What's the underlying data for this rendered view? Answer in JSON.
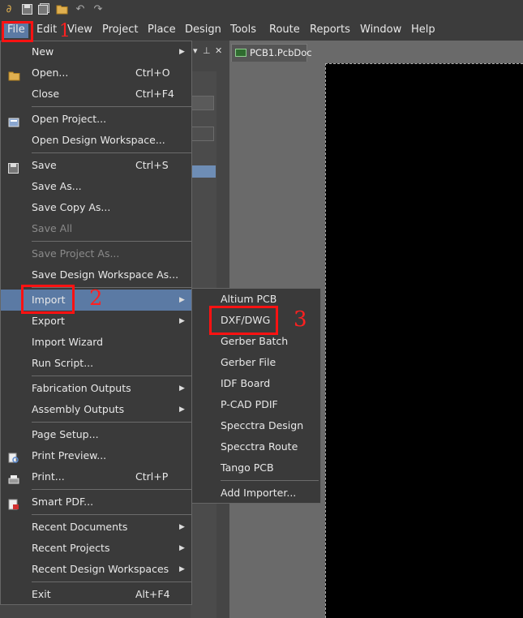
{
  "toolbar": {
    "icons": [
      "app-logo-icon",
      "save-icon",
      "save-all-icon",
      "open-folder-icon",
      "undo-icon",
      "redo-icon"
    ]
  },
  "menubar": {
    "items": [
      "File",
      "Edit",
      "View",
      "Project",
      "Place",
      "Design",
      "Tools",
      "Route",
      "Reports",
      "Window",
      "Help"
    ]
  },
  "document_tab": {
    "label": "PCB1.PcbDoc"
  },
  "file_menu": {
    "items": [
      {
        "label": "New",
        "submenu": true
      },
      {
        "label": "Open...",
        "shortcut": "Ctrl+O"
      },
      {
        "label": "Close",
        "shortcut": "Ctrl+F4"
      },
      {
        "label": "Open Project..."
      },
      {
        "label": "Open Design Workspace..."
      },
      {
        "label": "Save",
        "shortcut": "Ctrl+S"
      },
      {
        "label": "Save As..."
      },
      {
        "label": "Save Copy As..."
      },
      {
        "label": "Save All",
        "disabled": true
      },
      {
        "label": "Save Project As...",
        "disabled": true
      },
      {
        "label": "Save Design Workspace As..."
      },
      {
        "label": "Import",
        "submenu": true,
        "highlighted": true
      },
      {
        "label": "Export",
        "submenu": true
      },
      {
        "label": "Import Wizard"
      },
      {
        "label": "Run Script..."
      },
      {
        "label": "Fabrication Outputs",
        "submenu": true
      },
      {
        "label": "Assembly Outputs",
        "submenu": true
      },
      {
        "label": "Page Setup..."
      },
      {
        "label": "Print Preview..."
      },
      {
        "label": "Print...",
        "shortcut": "Ctrl+P"
      },
      {
        "label": "Smart PDF..."
      },
      {
        "label": "Recent Documents",
        "submenu": true
      },
      {
        "label": "Recent Projects",
        "submenu": true
      },
      {
        "label": "Recent Design Workspaces",
        "submenu": true
      },
      {
        "label": "Exit",
        "shortcut": "Alt+F4"
      }
    ]
  },
  "import_submenu": {
    "items": [
      "Altium PCB",
      "DXF/DWG",
      "Gerber Batch",
      "Gerber File",
      "IDF Board",
      "P-CAD PDIF",
      "Specctra Design",
      "Specctra Route",
      "Tango PCB",
      "Add Importer..."
    ]
  },
  "annotations": {
    "step1": "1",
    "step2": "2",
    "step3": "3",
    "color": "#ff1212"
  },
  "colors": {
    "highlight": "#5b7aa4",
    "menu_bg": "#3a3a3a",
    "canvas": "#000000"
  }
}
